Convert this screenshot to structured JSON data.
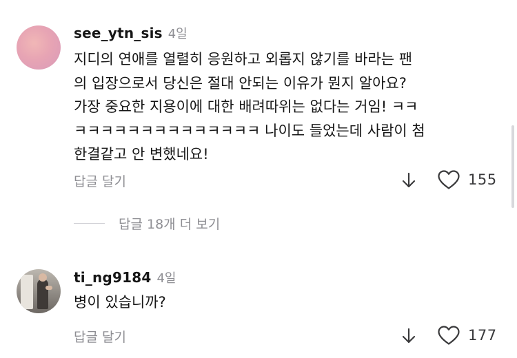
{
  "comments": [
    {
      "username": "see_ytn_sis",
      "time": "4일",
      "text": "지디의 연애를 열렬히 응원하고 외롭지 않기를 바라는 팬\n의 입장으로서 당신은 절대 안되는 이유가 뭔지 알아요?\n가장 중요한 지용이에 대한 배려따위는 없다는 거임! ㅋㅋ\nㅋㅋㅋㅋㅋㅋㅋㅋㅋㅋㅋㅋㅋㅋ 나이도 들었는데 사람이 첨\n한결같고 안 변했네요!",
      "reply_label": "답글 달기",
      "like_count": "155",
      "view_replies_label": "답글 18개 더 보기",
      "avatar_icon": "pink-gradient-avatar"
    },
    {
      "username": "ti_ng9184",
      "time": "4일",
      "text": "병이 있습니까?",
      "reply_label": "답글 달기",
      "like_count": "177",
      "avatar_icon": "photo-avatar"
    }
  ],
  "icons": {
    "dislike": "arrow-down-icon",
    "like": "heart-outline-icon"
  },
  "colors": {
    "text": "#161616",
    "muted": "#8e8e93",
    "icon": "#3a3a3c"
  }
}
